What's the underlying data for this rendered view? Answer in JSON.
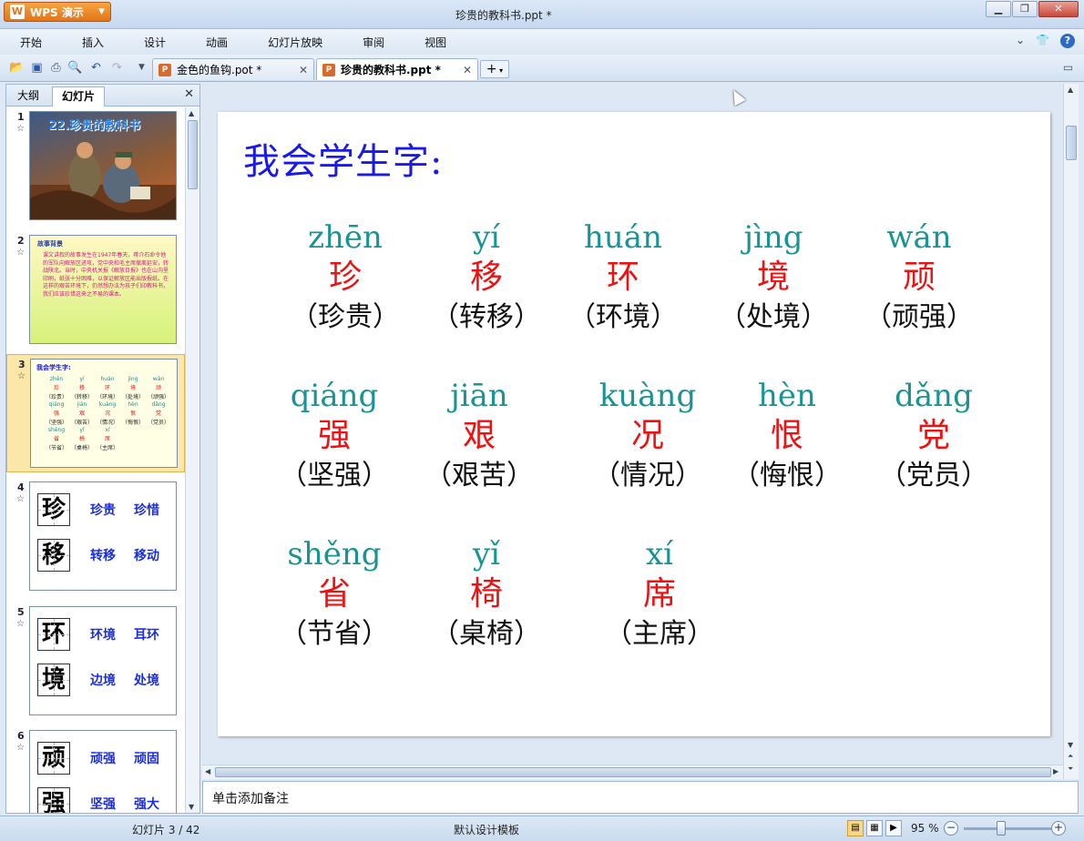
{
  "app": {
    "name": "WPS 演示",
    "window_title": "珍贵的教科书.ppt *"
  },
  "menu": {
    "items": [
      "开始",
      "插入",
      "设计",
      "动画",
      "幻灯片放映",
      "审阅",
      "视图"
    ]
  },
  "tabs": [
    {
      "label": "金色的鱼钩.pot *",
      "active": false
    },
    {
      "label": "珍贵的教科书.ppt *",
      "active": true
    }
  ],
  "left_pane": {
    "tabs": [
      "大纲",
      "幻灯片"
    ],
    "active_tab": "幻灯片",
    "thumbnails": {
      "s1": {
        "num": "1",
        "title": "22.珍贵的教科书"
      },
      "s2": {
        "num": "2",
        "heading": "故事背景",
        "text": "课文讲叙的故事发生在1947年春天，蒋介石命令他的军队向解放区进攻，党中央和毛主席撤离延安，转战陕北。当时，中央机关报《解放日报》也在山沟里印刷，纸张十分困难，以保证解放区能出版报纸。在这样的艰苦环境下，仍然想办法为孩子们印教科书，我们应该珍惜这来之不易的课本。"
      },
      "s3": {
        "num": "3",
        "heading": "我会学生字:"
      },
      "s4": {
        "num": "4",
        "chars": [
          "珍",
          "移"
        ],
        "words": [
          "珍贵",
          "珍惜",
          "转移",
          "移动"
        ]
      },
      "s5": {
        "num": "5",
        "chars": [
          "环",
          "境"
        ],
        "words": [
          "环境",
          "耳环",
          "边境",
          "处境"
        ]
      },
      "s6": {
        "num": "6",
        "chars": [
          "顽",
          "强"
        ],
        "words": [
          "顽强",
          "顽固",
          "坚强",
          "强大"
        ]
      }
    }
  },
  "slide": {
    "title": "我会学生字:",
    "rows": [
      [
        {
          "pinyin": "zhēn",
          "char": "珍",
          "word": "（珍贵）"
        },
        {
          "pinyin": "yí",
          "char": "移",
          "word": "（转移）"
        },
        {
          "pinyin": "huán",
          "char": "环",
          "word": "（环境）"
        },
        {
          "pinyin": "jìng",
          "char": "境",
          "word": "（处境）"
        },
        {
          "pinyin": "wán",
          "char": "顽",
          "word": "（顽强）"
        }
      ],
      [
        {
          "pinyin": "qiáng",
          "char": "强",
          "word": "（坚强）"
        },
        {
          "pinyin": "jiān",
          "char": "艰",
          "word": "（艰苦）"
        },
        {
          "pinyin": "kuàng",
          "char": "况",
          "word": "（情况）"
        },
        {
          "pinyin": "hèn",
          "char": "恨",
          "word": "（悔恨）"
        },
        {
          "pinyin": "dǎng",
          "char": "党",
          "word": "（党员）"
        }
      ],
      [
        {
          "pinyin": "shěng",
          "char": "省",
          "word": "（节省）"
        },
        {
          "pinyin": "yǐ",
          "char": "椅",
          "word": "（桌椅）"
        },
        {
          "pinyin": "xí",
          "char": "席",
          "word": "（主席）"
        }
      ]
    ]
  },
  "notes": {
    "placeholder": "单击添加备注"
  },
  "status": {
    "slide_counter": "幻灯片 3 / 42",
    "template": "默认设计模板",
    "zoom": "95 %"
  },
  "colors": {
    "title_blue": "#1a1ae6",
    "pinyin_teal": "#199393",
    "char_red": "#ee1111",
    "word_black": "#111111",
    "selection": "#fbe7a8",
    "wps_orange": "#e2741a"
  }
}
